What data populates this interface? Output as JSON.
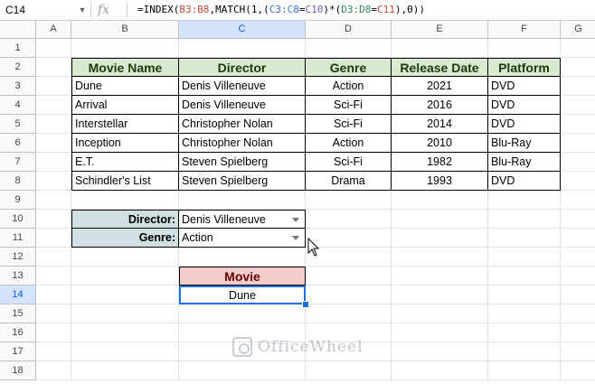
{
  "namebox": "C14",
  "formula_bar": {
    "fx": "fx",
    "parts": [
      {
        "t": "=INDEX(",
        "c": ""
      },
      {
        "t": "B3:B8",
        "c": "r1"
      },
      {
        "t": ",MATCH(1,(",
        "c": ""
      },
      {
        "t": "C3:C8",
        "c": "r2"
      },
      {
        "t": "=",
        "c": ""
      },
      {
        "t": "C10",
        "c": "r3"
      },
      {
        "t": ")*(",
        "c": ""
      },
      {
        "t": "D3:D8",
        "c": "r4"
      },
      {
        "t": "=",
        "c": ""
      },
      {
        "t": "C11",
        "c": "r1"
      },
      {
        "t": "),0))",
        "c": ""
      }
    ]
  },
  "columns": [
    "A",
    "B",
    "C",
    "D",
    "E",
    "F",
    "G"
  ],
  "rows": [
    "1",
    "2",
    "3",
    "4",
    "5",
    "6",
    "7",
    "8",
    "9",
    "10",
    "11",
    "12",
    "13",
    "14",
    "15",
    "16",
    "17",
    "18"
  ],
  "selected_column": "C",
  "selected_row": "14",
  "table": {
    "headers": [
      "Movie Name",
      "Director",
      "Genre",
      "Release Date",
      "Platform"
    ],
    "rows": [
      [
        "Dune",
        "Denis Villeneuve",
        "Action",
        "2021",
        "DVD"
      ],
      [
        "Arrival",
        "Denis Villeneuve",
        "Sci-Fi",
        "2016",
        "DVD"
      ],
      [
        "Interstellar",
        "Christopher Nolan",
        "Sci-Fi",
        "2014",
        "DVD"
      ],
      [
        "Inception",
        "Christopher Nolan",
        "Action",
        "2010",
        "Blu-Ray"
      ],
      [
        "E.T.",
        "Steven Spielberg",
        "Sci-Fi",
        "1982",
        "Blu-Ray"
      ],
      [
        "Schindler's List",
        "Steven Spielberg",
        "Drama",
        "1993",
        "DVD"
      ]
    ]
  },
  "criteria": {
    "director_label": "Director:",
    "director_value": "Denis Villeneuve",
    "genre_label": "Genre:",
    "genre_value": "Action"
  },
  "result": {
    "header": "Movie",
    "value": "Dune"
  },
  "watermark": "OfficeWheel",
  "colors": {
    "table_header_bg": "#d9ead3",
    "criteria_label_bg": "#d0e0e3",
    "result_header_bg": "#f4cccc",
    "selection_blue": "#1a73e8"
  }
}
